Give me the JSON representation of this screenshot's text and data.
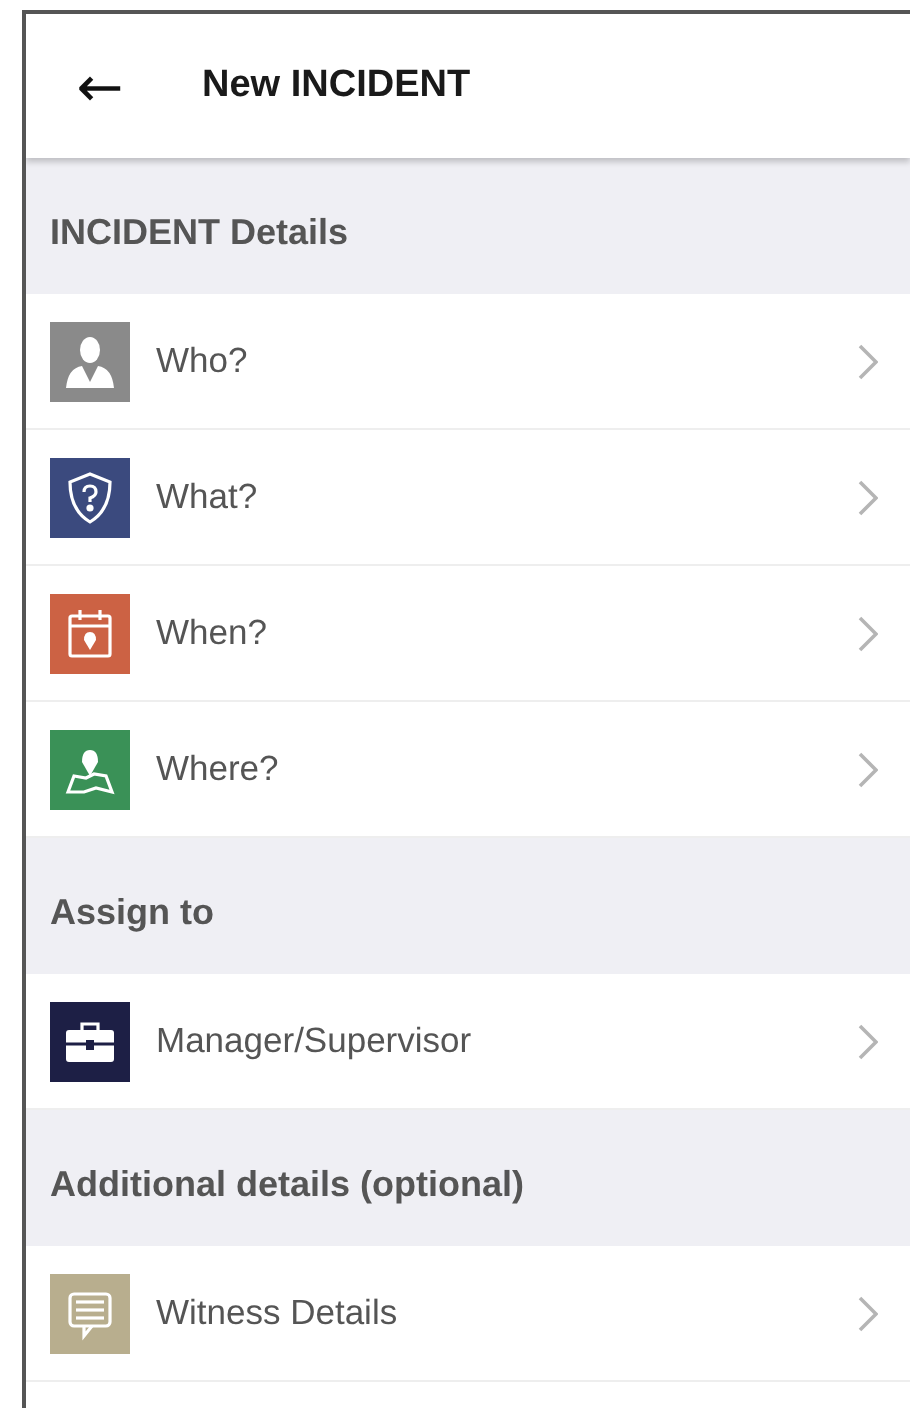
{
  "header": {
    "back_icon": "←",
    "title": "New INCIDENT"
  },
  "sections": [
    {
      "title": "INCIDENT Details",
      "items": [
        {
          "label": "Who?",
          "kind": "person",
          "color": "#8a8a8a"
        },
        {
          "label": "What?",
          "kind": "shield",
          "color": "#3b4a7e"
        },
        {
          "label": "When?",
          "kind": "calendar",
          "color": "#cc6244"
        },
        {
          "label": "Where?",
          "kind": "map",
          "color": "#3a9157"
        }
      ]
    },
    {
      "title": "Assign to",
      "items": [
        {
          "label": "Manager/Supervisor",
          "kind": "briefcase",
          "color": "#1d1f45"
        }
      ]
    },
    {
      "title": "Additional details (optional)",
      "items": [
        {
          "label": "Witness Details",
          "kind": "chat",
          "color": "#b8ae8e"
        }
      ]
    }
  ]
}
